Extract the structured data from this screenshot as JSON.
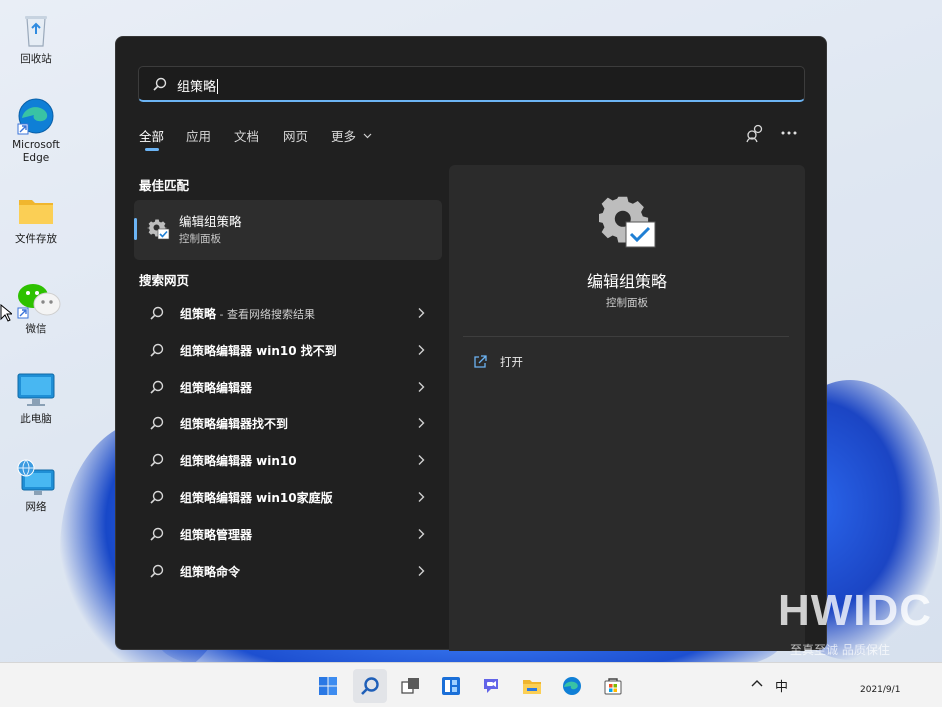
{
  "desktop": {
    "icons": [
      {
        "label": "回收站",
        "icon": "recycle-bin-icon"
      },
      {
        "label": "Microsoft\nEdge",
        "icon": "edge-icon"
      },
      {
        "label": "文件存放",
        "icon": "folder-icon"
      },
      {
        "label": "微信",
        "icon": "wechat-icon"
      },
      {
        "label": "此电脑",
        "icon": "this-pc-icon"
      },
      {
        "label": "网络",
        "icon": "network-icon"
      }
    ]
  },
  "search": {
    "query": "组策略",
    "tabs": [
      "全部",
      "应用",
      "文档",
      "网页",
      "更多"
    ],
    "best_match_title": "最佳匹配",
    "best_match": {
      "name": "编辑组策略",
      "subtitle": "控制面板",
      "icon": "group-policy-gear-icon"
    },
    "web_title": "搜索网页",
    "web_results": [
      {
        "text": "组策略",
        "suffix": " - 查看网络搜索结果"
      },
      {
        "text": "组策略编辑器 win10 找不到",
        "suffix": ""
      },
      {
        "text": "组策略编辑器",
        "suffix": ""
      },
      {
        "text": "组策略编辑器找不到",
        "suffix": ""
      },
      {
        "text": "组策略编辑器 win10",
        "suffix": ""
      },
      {
        "text": "组策略编辑器 win10家庭版",
        "suffix": ""
      },
      {
        "text": "组策略管理器",
        "suffix": ""
      },
      {
        "text": "组策略命令",
        "suffix": ""
      }
    ],
    "detail": {
      "name": "编辑组策略",
      "subtitle": "控制面板",
      "action_open": "打开"
    }
  },
  "watermark": {
    "brand": "HWIDC",
    "tagline": "至真至诚 品质保住"
  },
  "taskbar": {
    "apps": [
      "start-icon",
      "search-icon",
      "task-view-icon",
      "widgets-icon",
      "chat-icon",
      "file-explorer-icon",
      "edge-icon",
      "store-icon"
    ],
    "ime": "中",
    "date": "2021/9/1"
  },
  "colors": {
    "accent": "#6cb4f4",
    "panel": "#202020",
    "detail_pane": "#2b2b2b",
    "taskbar": "#f3f3f3"
  }
}
